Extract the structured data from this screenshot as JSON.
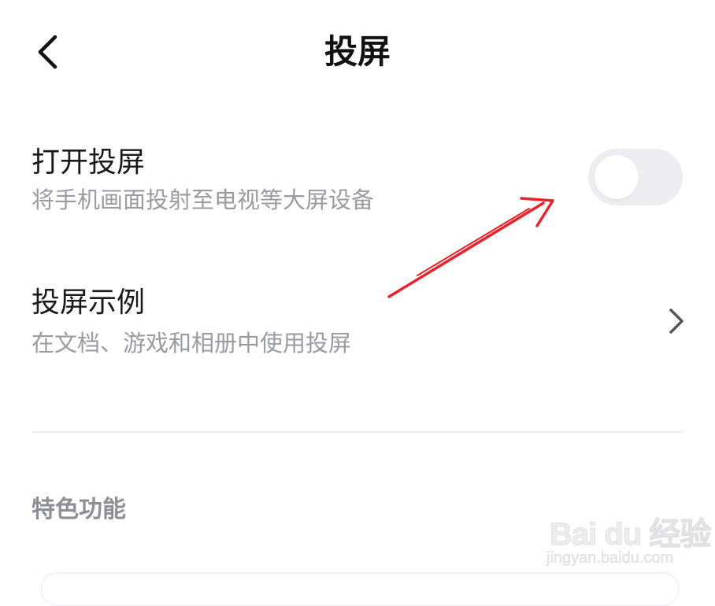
{
  "header": {
    "title": "投屏"
  },
  "settings": [
    {
      "title": "打开投屏",
      "subtitle": "将手机画面投射至电视等大屏设备",
      "control": "toggle",
      "toggle_on": false
    },
    {
      "title": "投屏示例",
      "subtitle": "在文档、游戏和相册中使用投屏",
      "control": "chevron"
    }
  ],
  "section": {
    "label": "特色功能"
  },
  "watermark": {
    "logo_text": "Bai du 经验",
    "url": "jingyan.baidu.com"
  },
  "colors": {
    "annotation_arrow": "#e8232c",
    "toggle_track_off": "#ececf1",
    "subtitle_text": "#9b9ba3"
  },
  "icons": {
    "back": "chevron-left-icon",
    "row_arrow": "chevron-right-icon"
  }
}
